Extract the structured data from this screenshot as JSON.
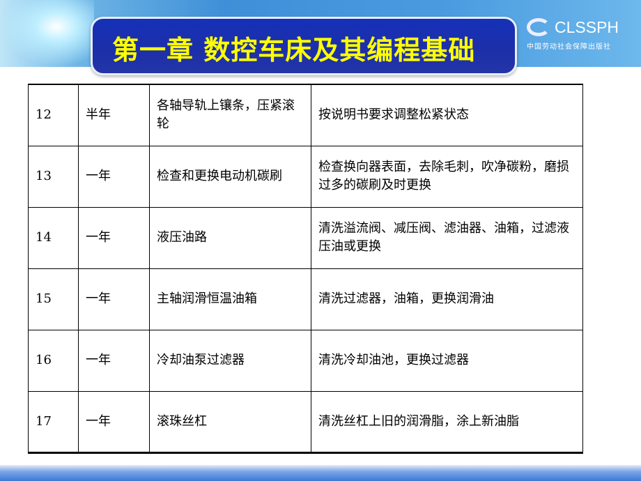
{
  "header": {
    "title": "第一章 数控车床及其编程基础"
  },
  "logo": {
    "name": "CLSSPH",
    "subtitle": "中国劳动社会保障出版社"
  },
  "table": {
    "rows": [
      [
        "12",
        "半年",
        "各轴导轨上镶条，压紧滚轮",
        "按说明书要求调整松紧状态"
      ],
      [
        "13",
        "一年",
        "检查和更换电动机碳刷",
        "检查换向器表面，去除毛刺，吹净碳粉，磨损过多的碳刷及时更换"
      ],
      [
        "14",
        "一年",
        "液压油路",
        "清洗溢流阀、减压阀、滤油器、油箱，过滤液压油或更换"
      ],
      [
        "15",
        "一年",
        "主轴润滑恒温油箱",
        "清洗过滤器，油箱，更换润滑油"
      ],
      [
        "16",
        "一年",
        "冷却油泵过滤器",
        "清洗冷却油池，更换过滤器"
      ],
      [
        "17",
        "一年",
        "滚珠丝杠",
        "清洗丝杠上旧的润滑脂，涂上新油脂"
      ]
    ]
  }
}
